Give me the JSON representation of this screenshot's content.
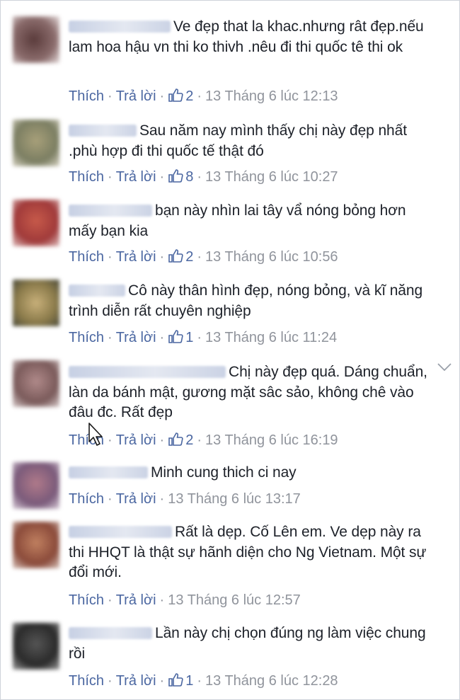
{
  "labels": {
    "like": "Thích",
    "reply": "Trả lời",
    "separator": "·"
  },
  "comments": [
    {
      "text": "Ve đẹp that la khac.nhưng rât đẹp.nếu lam hoa hậu vn thi ko thivh .nêu đi thi quốc tê thi ok",
      "likes": "2",
      "time": "13 Tháng 6 lúc 12:13",
      "avatar": "#6a4a4a"
    },
    {
      "text": "Sau năm nay mình thấy chị này đẹp nhất .phù hợp đi thi quốc tế thật đó",
      "likes": "8",
      "time": "13 Tháng 6 lúc 10:27",
      "avatar": "#8f8a6e"
    },
    {
      "text": "bạn này nhìn lai tây vẩ nóng bỏng hơn mấy bạn kia",
      "likes": "2",
      "time": "13 Tháng 6 lúc 10:56",
      "avatar": "#b04a4a"
    },
    {
      "text": "Cô này thân hình đẹp, nóng bỏng, và kĩ năng trình diễn rất chuyên nghiệp",
      "likes": "1",
      "time": "13 Tháng 6 lúc 11:24",
      "avatar": "#9a8a5a"
    },
    {
      "text": "Chị này đẹp quá. Dáng chuẩn, làn da bánh mật, gương mặt sâc sảo, không chê vào đâu đc. Rất đẹp",
      "likes": "2",
      "time": "13 Tháng 6 lúc 16:19",
      "avatar": "#8a6a6a"
    },
    {
      "text": "Minh cung thich ci nay",
      "likes": "",
      "time": "13 Tháng 6 lúc 13:17",
      "avatar": "#9a7a8a"
    },
    {
      "text": "Rất là dẹp. Cố Lên em. Ve dẹp này ra thi HHQT là thật sự hãnh diện cho Ng Vietnam. Một sự đổi mới.",
      "likes": "",
      "time": "13 Tháng 6 lúc 12:57",
      "avatar": "#8a5a4a"
    },
    {
      "text": "Lần này chị chọn đúng ng làm việc chung rồi",
      "likes": "1",
      "time": "13 Tháng 6 lúc 12:28",
      "avatar": "#3a3a3a"
    }
  ],
  "icons": {
    "like": "thumbs-up-icon",
    "options": "chevron-down-icon",
    "cursor": "mouse-pointer-icon"
  },
  "colors": {
    "link": "#4b67a1",
    "text": "#1d2129",
    "meta": "#90949c"
  }
}
